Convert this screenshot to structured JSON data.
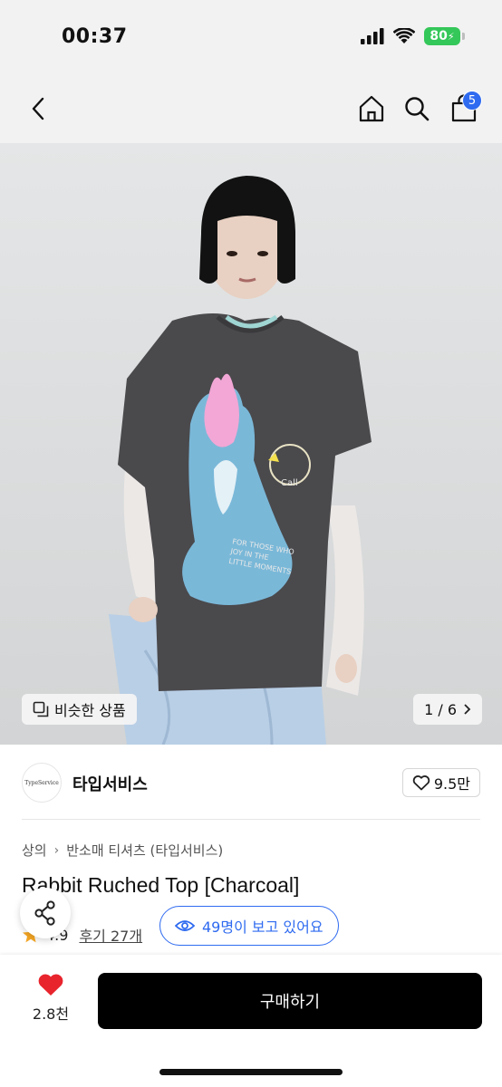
{
  "status_bar": {
    "time": "00:37",
    "battery": "80"
  },
  "nav": {
    "cart_count": "5"
  },
  "image": {
    "similar_label": "비슷한 상품",
    "page_indicator": "1 / 6",
    "shirt_text": [
      "FOR THOSE WHO",
      "JOY IN THE",
      "LITTLE MOMENTS",
      "Call"
    ]
  },
  "brand": {
    "logo_text": "TypeService",
    "name": "타입서비스",
    "likes": "9.5만"
  },
  "breadcrumb": {
    "items": [
      "상의",
      "반소매 티셔츠 (타입서비스)"
    ]
  },
  "product": {
    "title": "Rabbit Ruched Top [Charcoal]",
    "rating": "4.9",
    "reviews": "후기 27개",
    "viewers": "49명이 보고 있어요"
  },
  "bottom_bar": {
    "wish_count": "2.8천",
    "buy_label": "구매하기"
  },
  "colors": {
    "accent_blue": "#2f6bf0",
    "heart_red": "#e8242c",
    "star_orange": "#f5a623",
    "battery_green": "#34c759"
  }
}
